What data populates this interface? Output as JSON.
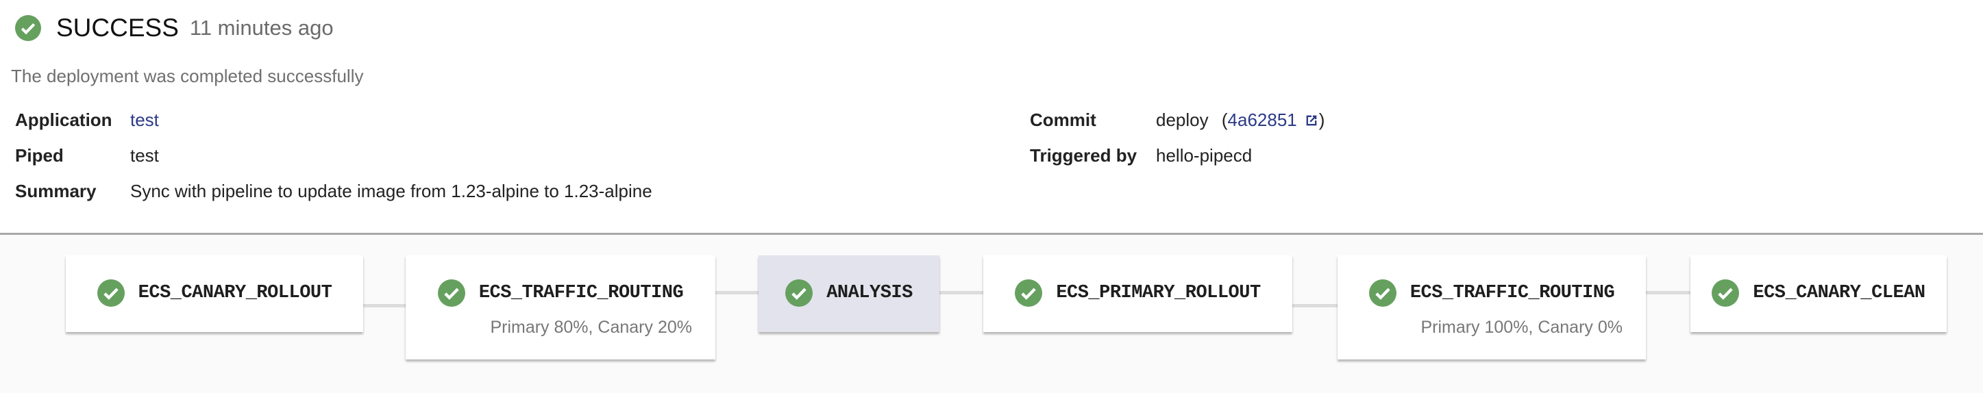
{
  "deployment": {
    "status": "SUCCESS",
    "status_icon": "check-circle-icon",
    "time_ago": "11 minutes ago",
    "description": "The deployment was completed successfully",
    "success_color": "#65a05f",
    "link_color": "#2c3a86"
  },
  "details": {
    "left": [
      {
        "label": "Application",
        "value": "test"
      },
      {
        "label": "Piped",
        "value": "test"
      },
      {
        "label": "Summary",
        "value": "Sync with pipeline to update image from 1.23-alpine to 1.23-alpine"
      }
    ],
    "commit": {
      "label": "Commit",
      "message": "deploy",
      "open_paren": "(",
      "hash": "4a62851",
      "close_paren": ")"
    },
    "triggered_by": {
      "label": "Triggered by",
      "value": "hello-pipecd"
    }
  },
  "pipeline": {
    "stages": [
      {
        "name": "ECS_CANARY_ROLLOUT",
        "status": "success",
        "description": ""
      },
      {
        "name": "ECS_TRAFFIC_ROUTING",
        "status": "success",
        "description": "Primary 80%, Canary 20%"
      },
      {
        "name": "ANALYSIS",
        "status": "success",
        "description": "",
        "active": true
      },
      {
        "name": "ECS_PRIMARY_ROLLOUT",
        "status": "success",
        "description": ""
      },
      {
        "name": "ECS_TRAFFIC_ROUTING",
        "status": "success",
        "description": "Primary 100%, Canary 0%"
      },
      {
        "name": "ECS_CANARY_CLEAN",
        "status": "success",
        "description": ""
      }
    ]
  }
}
